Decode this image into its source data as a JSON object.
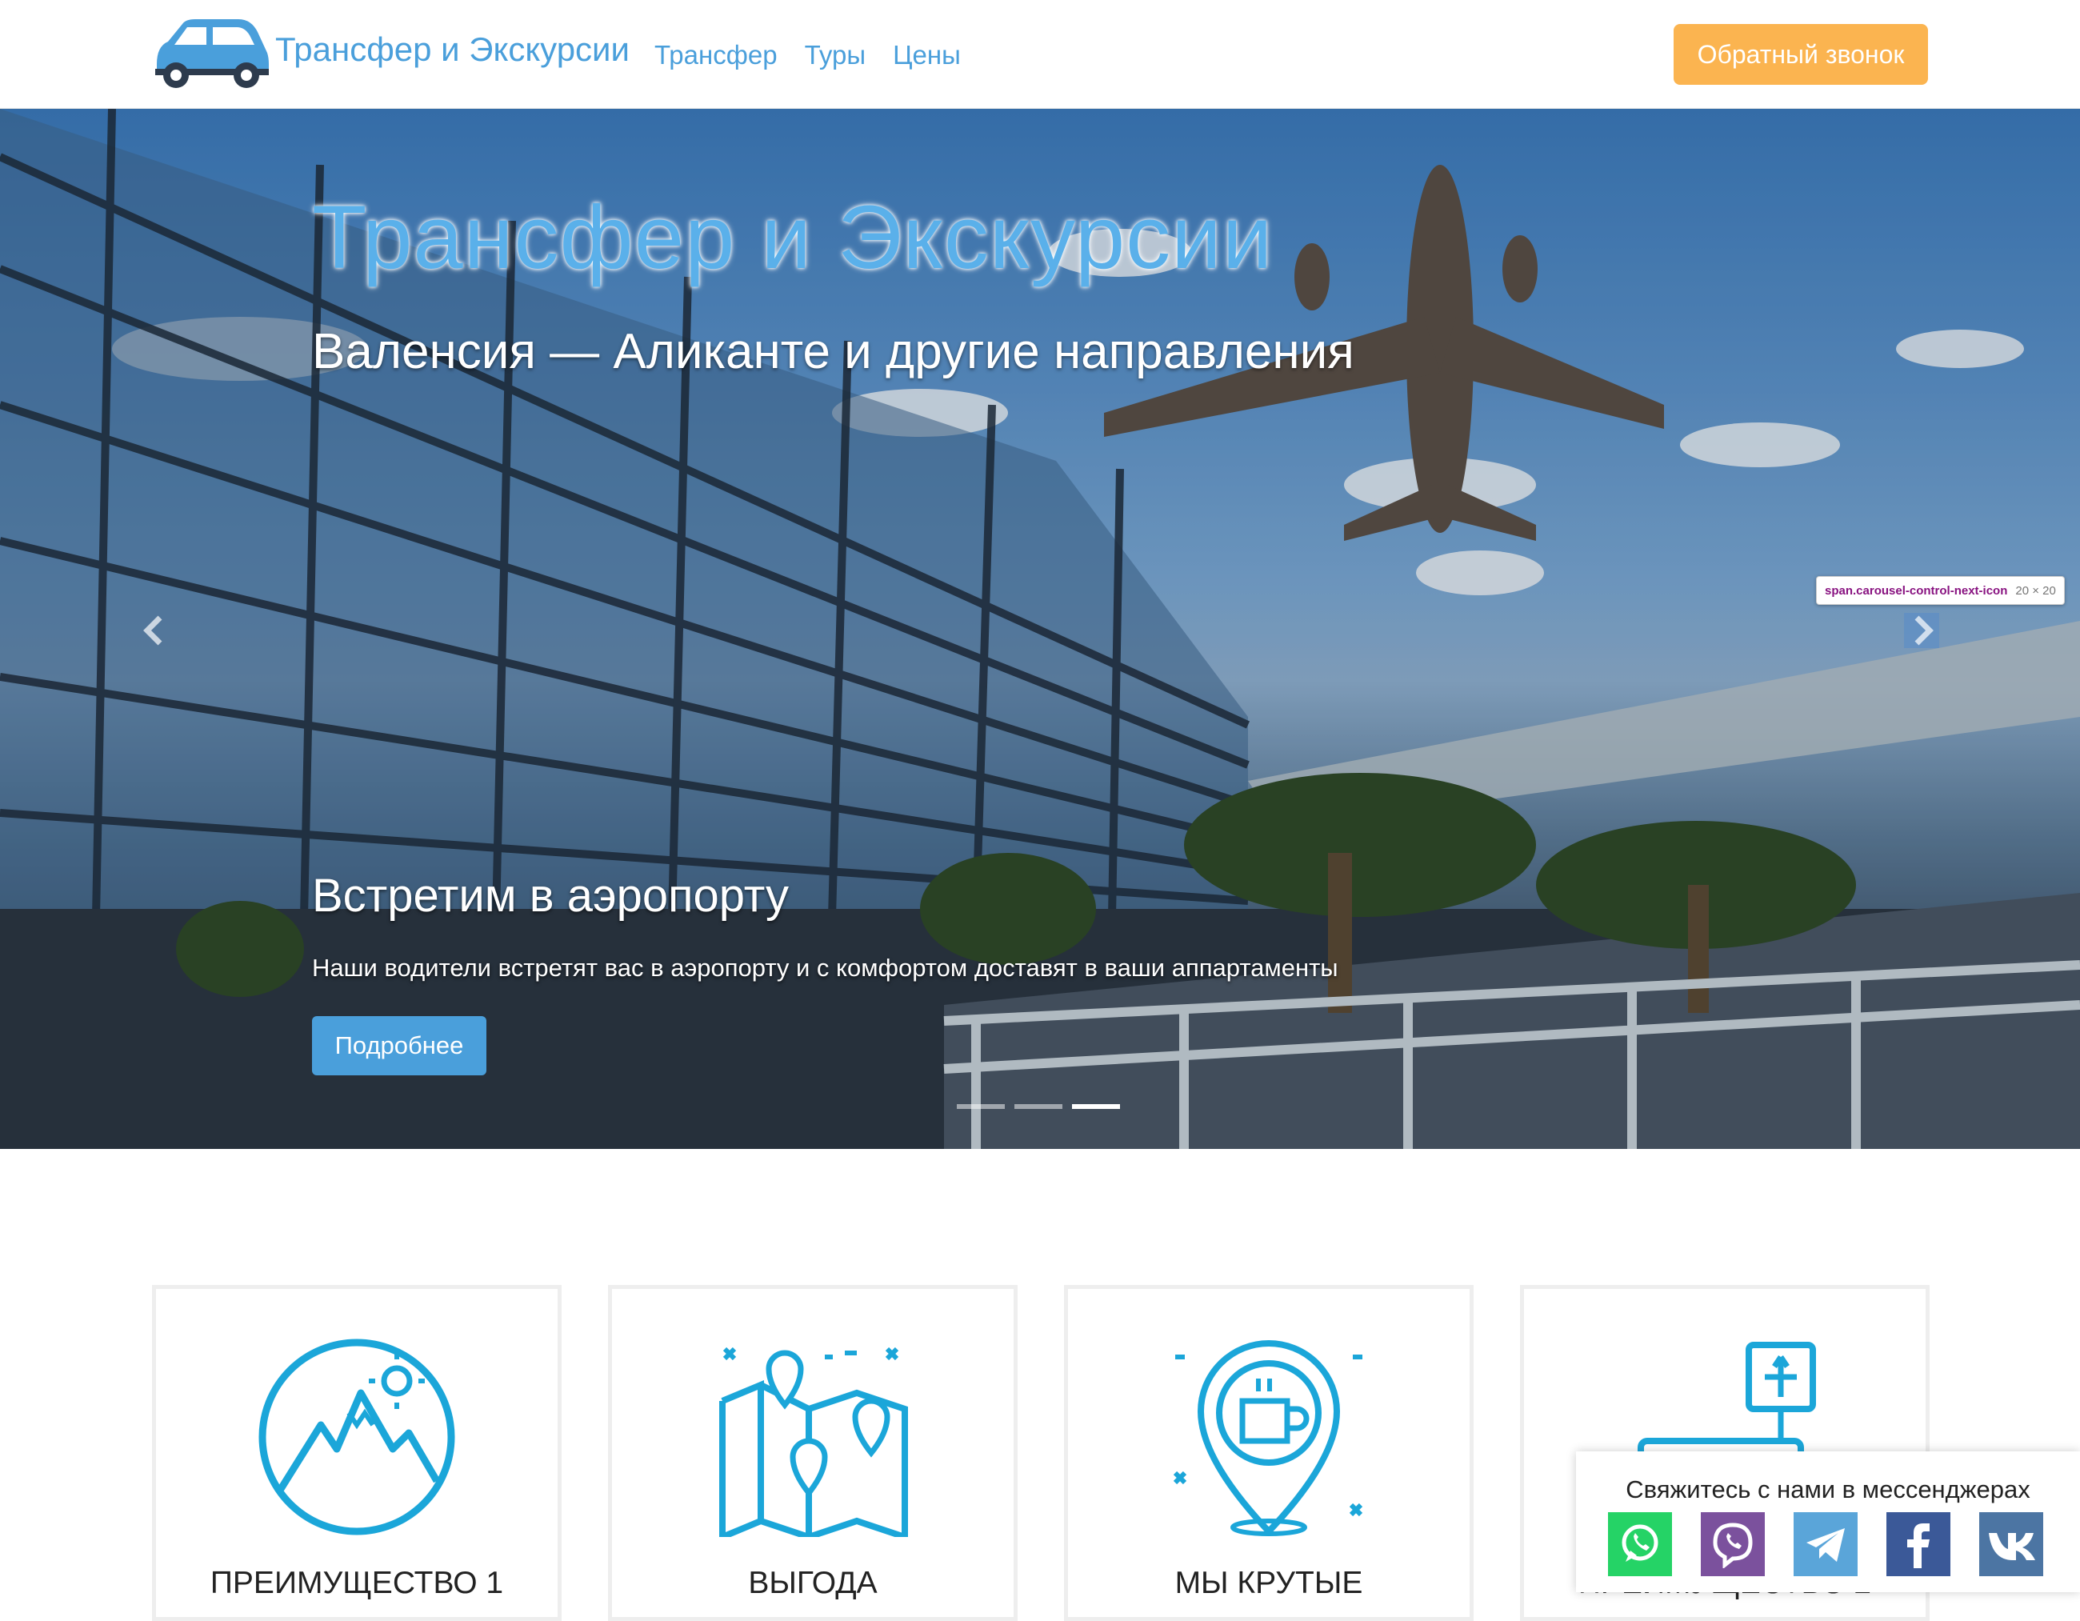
{
  "header": {
    "brand": "Трансфер и Экскурсии",
    "nav": [
      "Трансфер",
      "Туры",
      "Цены"
    ],
    "callback_label": "Обратный звонок",
    "logo_icon": "car-icon"
  },
  "hero": {
    "title": "Трансфер и Экскурсии",
    "subtitle": "Валенсия — Аликанте и другие направления",
    "slide_title": "Встретим в аэропорту",
    "slide_text": "Наши водители встретят вас в аэропорту и с комфортом доставят в ваши аппартаменты",
    "more_label": "Подробнее",
    "active_slide": 3,
    "slides_count": 3,
    "tooltip_name": "span.carousel-control-next-icon",
    "tooltip_size": "20 × 20"
  },
  "cards": [
    {
      "title": "ПРЕИМУЩЕСТВО 1",
      "icon": "mountains-icon"
    },
    {
      "title": "ВЫГОДА",
      "icon": "map-pins-icon"
    },
    {
      "title": "МЫ КРУТЫЕ",
      "icon": "coffee-pin-icon"
    },
    {
      "title": "ПРЕИМУЩЕСТВО 2",
      "icon": "airport-sign-icon"
    }
  ],
  "messenger": {
    "title": "Свяжитесь с нами в мессенджерах",
    "icons": [
      "whatsapp-icon",
      "viber-icon",
      "telegram-icon",
      "facebook-icon",
      "vk-icon"
    ],
    "colors": {
      "whatsapp": "#25d366",
      "viber": "#7b519d",
      "telegram": "#5aa5d9",
      "facebook": "#3b5998",
      "vk": "#4c75a3"
    }
  },
  "colors": {
    "accent": "#4a9fdb",
    "callback": "#fbb450",
    "icon_blue": "#1ba6d9"
  }
}
